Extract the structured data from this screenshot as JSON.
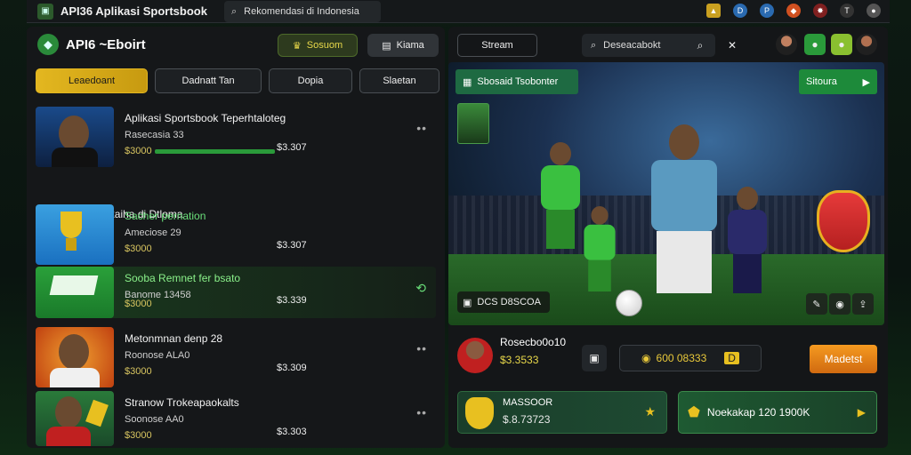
{
  "browser": {
    "tab_title": "API36 Aplikasi Sportsbook",
    "url": "Rekomendasi di Indonesia"
  },
  "left": {
    "brand": "API6 ~Eboirt",
    "btn_green": "Sosuom",
    "btn_dark": "Kiama",
    "tabs": [
      "Leaedoant",
      "Dadnatt Tan",
      "Dopia",
      "Slaetan"
    ],
    "section_title": "Rohgam Rekaiha di Dtloma",
    "items": [
      {
        "name": "Aplikasi Sportsbook Teperhtaloteg",
        "sub": "Rasecasia 33",
        "amt": "$3000",
        "price": "$3.307"
      },
      {
        "name": "Sacher pernation",
        "sub": "Ameciose 29",
        "amt": "$3000",
        "price": "$3.307"
      },
      {
        "name": "Sooba Remnet fer bsato",
        "sub": "Banome 13458",
        "amt": "$3000",
        "price": "$3.339"
      },
      {
        "name": "Metonmnan denp 28",
        "sub": "Roonose ALA0",
        "amt": "$3000",
        "price": "$3.309"
      },
      {
        "name": "Stranow Trokeapaokalts",
        "sub": "Soonose AA0",
        "amt": "$3000",
        "price": "$3.303"
      }
    ]
  },
  "right": {
    "stream_label": "Stream",
    "search_placeholder": "Deseacabokt",
    "hero_badge": "Sbosaid Tsobonter",
    "hero_btn": "Sitoura",
    "hero_chip": "DCS D8SCOA",
    "bottom_name": "Rosecbo0o10",
    "bottom_odd": "$3.3533",
    "coin_value": "600 08333",
    "orange_btn": "Madetst",
    "card1_title": "MASSOOR",
    "card1_value": "$.8.73723",
    "card2_text": "Noekakap 120 1900K"
  }
}
